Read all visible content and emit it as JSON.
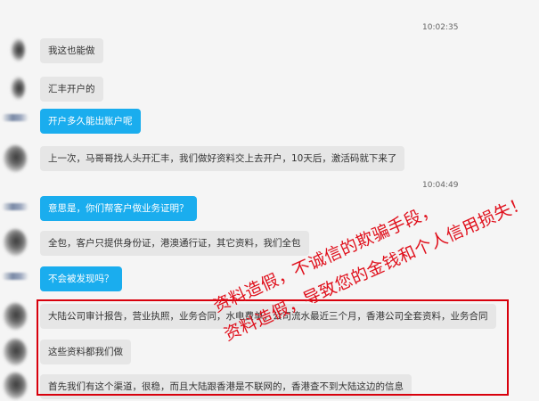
{
  "chat": {
    "timestamps": [
      "10:02:35",
      "10:04:49"
    ],
    "messages": [
      {
        "side": "received",
        "text": "我这也能做"
      },
      {
        "side": "received",
        "text": "汇丰开户的"
      },
      {
        "side": "sent",
        "text": "开户多久能出账户呢"
      },
      {
        "side": "received",
        "text": "上一次，马哥哥找人头开汇丰，我们做好资料交上去开户，10天后，激活码就下来了"
      },
      {
        "side": "sent",
        "text": "意思是，你们帮客户做业务证明？"
      },
      {
        "side": "received",
        "text": "全包，客户只提供身份证，港澳通行证，其它资料，我们全包"
      },
      {
        "side": "sent",
        "text": "不会被发现吗？"
      },
      {
        "side": "received",
        "text": "大陆公司审计报告，营业执照，业务合同，水电费单，公司流水最近三个月，香港公司全套资料，业务合同"
      },
      {
        "side": "received",
        "text": "这些资料都我们做"
      },
      {
        "side": "received",
        "text": "首先我们有这个渠道，很稳，而且大陆跟香港是不联网的，香港查不到大陆这边的信息"
      }
    ]
  },
  "overlay": {
    "warning_line1": "资料造假，不诚信的欺骗手段，",
    "warning_line2": "资料造假，导致您的金钱和个人信用损失！",
    "box_color": "#d8000c",
    "text_color": "#e0101c"
  },
  "colors": {
    "sent_bubble": "#1aadee",
    "received_bubble": "#e6e6e6",
    "background": "#f5f5f5"
  }
}
